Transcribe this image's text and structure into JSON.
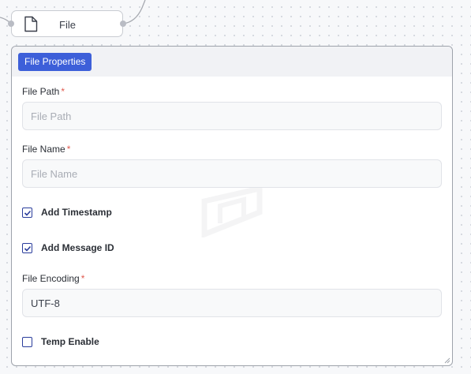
{
  "node": {
    "label": "File",
    "icon": "document-icon"
  },
  "panel": {
    "tag": "File Properties",
    "file_path": {
      "label": "File Path",
      "required": "*",
      "value": "",
      "placeholder": "File Path"
    },
    "file_name": {
      "label": "File Name",
      "required": "*",
      "value": "",
      "placeholder": "File Name"
    },
    "add_timestamp": {
      "label": "Add Timestamp",
      "checked": true
    },
    "add_message_id": {
      "label": "Add Message ID",
      "checked": true
    },
    "file_encoding": {
      "label": "File Encoding",
      "required": "*",
      "value": "UTF-8"
    },
    "temp_enable": {
      "label": "Temp Enable",
      "checked": false
    }
  },
  "colors": {
    "accent": "#3d5fd9",
    "checkbox": "#2a3d9c",
    "required": "#e05a4f"
  }
}
